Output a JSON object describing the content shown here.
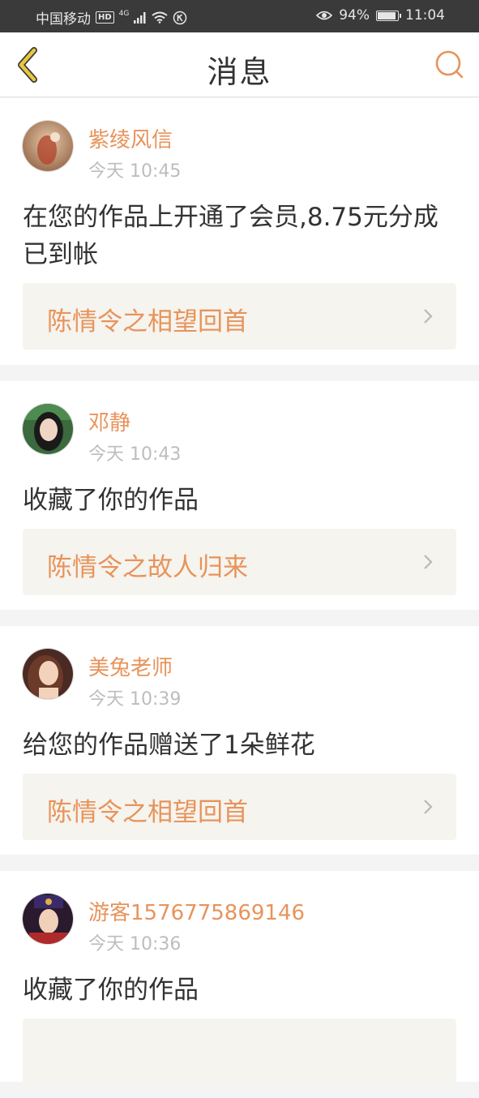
{
  "status_bar": {
    "carrier": "中国移动",
    "hd": "HD",
    "network": "4G",
    "battery_percent": "94%",
    "battery_level": 0.94,
    "time": "11:04"
  },
  "header": {
    "title": "消息",
    "back_icon": "chevron-left-icon",
    "search_icon": "search-icon"
  },
  "colors": {
    "accent": "#e8935b",
    "back_icon": "#e8c740",
    "link_bg": "#f5f4ee",
    "separator": "#f4f4f4"
  },
  "messages": [
    {
      "username": "紫绫风信",
      "time": "今天 10:45",
      "text": "在您的作品上开通了会员,8.75元分成已到帐",
      "work_title": "陈情令之相望回首"
    },
    {
      "username": "邓静",
      "time": "今天 10:43",
      "text": "收藏了你的作品",
      "work_title": "陈情令之故人归来"
    },
    {
      "username": "美兔老师",
      "time": "今天 10:39",
      "text": "给您的作品赠送了1朵鲜花",
      "work_title": "陈情令之相望回首"
    },
    {
      "username": "游客1576775869146",
      "time": "今天 10:36",
      "text": "收藏了你的作品",
      "work_title": ""
    }
  ]
}
